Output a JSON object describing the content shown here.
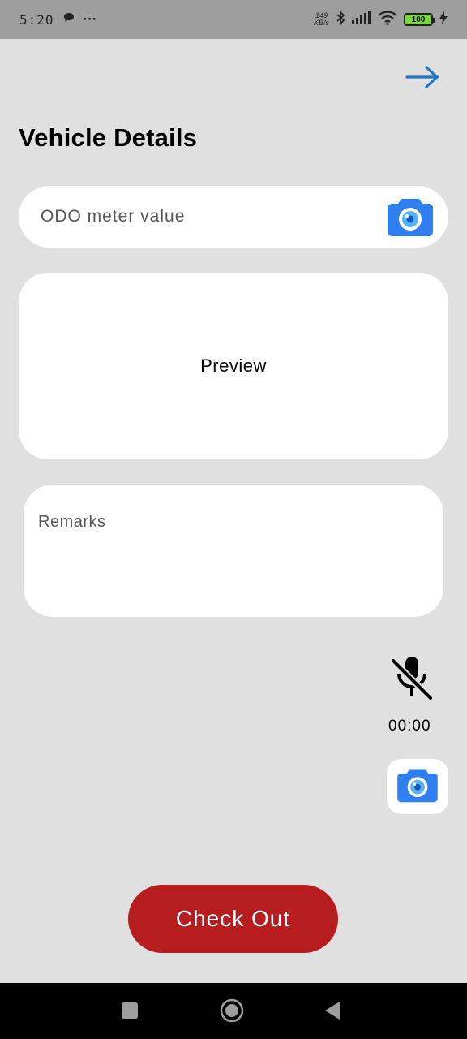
{
  "status_bar": {
    "time": "5:20",
    "more": "···",
    "net_speed_value": "149",
    "net_speed_unit": "KB/s",
    "battery": "100"
  },
  "header": {
    "title": "Vehicle Details",
    "next_icon": "arrow-right-icon"
  },
  "odo": {
    "placeholder": "ODO meter value",
    "camera_icon": "camera-icon"
  },
  "preview": {
    "label": "Preview"
  },
  "remarks": {
    "placeholder": "Remarks"
  },
  "audio": {
    "mic_icon": "mic-off-icon",
    "timer": "00:00"
  },
  "actions": {
    "checkout_label": "Check Out"
  },
  "colors": {
    "accent_blue": "#1e78c8",
    "camera_blue": "#2f7ff0",
    "checkout_red": "#b71c1f",
    "background": "#e0e0e0"
  }
}
